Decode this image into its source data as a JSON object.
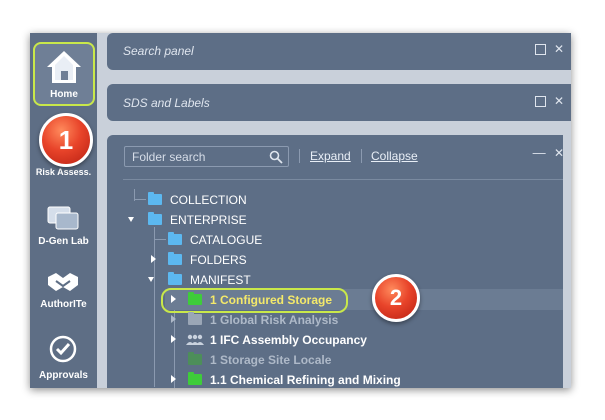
{
  "rail": {
    "items": [
      {
        "label": "Home",
        "icon": "home-icon"
      },
      {
        "label": "Risk Assess.",
        "icon": "risk-icon"
      },
      {
        "label": "D-Gen Lab",
        "icon": "dgen-lab-icon"
      },
      {
        "label": "AuthorITe",
        "icon": "handshake-icon"
      },
      {
        "label": "Approvals",
        "icon": "check-circle-icon"
      }
    ]
  },
  "callouts": [
    "1",
    "2"
  ],
  "panels": {
    "search": {
      "title": "Search panel"
    },
    "sds": {
      "title": "SDS and Labels"
    },
    "folders": {
      "search_placeholder": "Folder search",
      "expand_label": "Expand",
      "collapse_label": "Collapse"
    }
  },
  "tree": {
    "items": [
      {
        "label": "COLLECTION"
      },
      {
        "label": "ENTERPRISE"
      },
      {
        "label": "CATALOGUE"
      },
      {
        "label": "FOLDERS"
      },
      {
        "label": "MANIFEST"
      },
      {
        "label": "1 Configured Storage"
      },
      {
        "label": "1 Global Risk Analysis"
      },
      {
        "label": "1 IFC Assembly Occupancy"
      },
      {
        "label": "1 Storage Site Locale"
      },
      {
        "label": "1.1 Chemical Refining and Mixing"
      }
    ]
  },
  "colors": {
    "rail": "#5e6e85",
    "panel": "#5d6e86",
    "highlight_border": "#c9e84a",
    "folder_blue": "#5cb8f0",
    "folder_green": "#3ecc3a",
    "callout_red": "#e8442a"
  }
}
